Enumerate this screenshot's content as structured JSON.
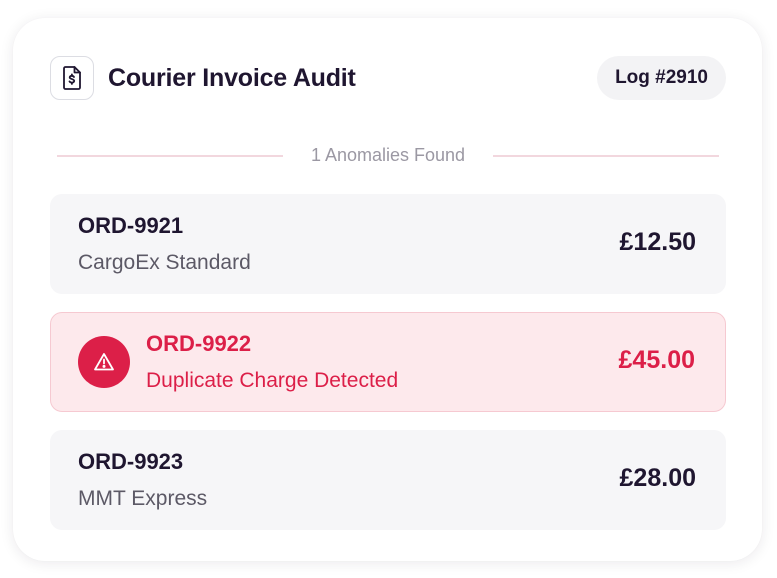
{
  "header": {
    "icon": "invoice-document-icon",
    "title": "Courier Invoice Audit",
    "log_badge": "Log #2910"
  },
  "summary": {
    "anomalies_text": "1 Anomalies Found"
  },
  "rows": [
    {
      "order_id": "ORD-9921",
      "subtitle": "CargoEx Standard",
      "amount": "£12.50",
      "status": "normal"
    },
    {
      "order_id": "ORD-9922",
      "subtitle": "Duplicate Charge Detected",
      "amount": "£45.00",
      "status": "anomaly",
      "icon": "warning-triangle-icon"
    },
    {
      "order_id": "ORD-9923",
      "subtitle": "MMT Express",
      "amount": "£28.00",
      "status": "normal"
    }
  ],
  "colors": {
    "text_primary": "#1f1630",
    "alert_accent": "#dc1f48",
    "alert_bg": "#fde9ec",
    "row_bg": "#f6f6f8"
  }
}
